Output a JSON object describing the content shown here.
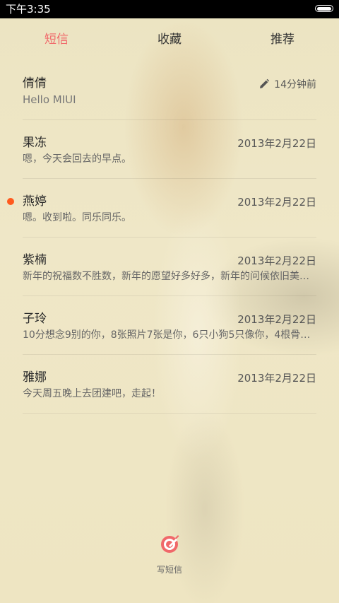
{
  "status": {
    "time": "下午3:35"
  },
  "tabs": [
    {
      "label": "短信",
      "active": true
    },
    {
      "label": "收藏",
      "active": false
    },
    {
      "label": "推荐",
      "active": false
    }
  ],
  "threads": [
    {
      "name": "倩倩",
      "preview": "Hello MIUI",
      "time": "14分钟前",
      "draft": true,
      "unread": false
    },
    {
      "name": "果冻",
      "preview": "嗯，今天会回去的早点。",
      "time": "2013年2月22日",
      "draft": false,
      "unread": false
    },
    {
      "name": "燕婷",
      "preview": "嗯。收到啦。同乐同乐。",
      "time": "2013年2月22日",
      "draft": false,
      "unread": true
    },
    {
      "name": "紫楠",
      "preview": "新年的祝福数不胜数，新年的愿望好多好多，新年的问候依旧美好…",
      "time": "2013年2月22日",
      "draft": false,
      "unread": false
    },
    {
      "name": "子玲",
      "preview": "10分想念9别的你，8张照片7张是你，6只小狗5只像你，4根骨头…",
      "time": "2013年2月22日",
      "draft": false,
      "unread": false
    },
    {
      "name": "雅娜",
      "preview": "今天周五晚上去团建吧，走起！",
      "time": "2013年2月22日",
      "draft": false,
      "unread": false
    }
  ],
  "compose": {
    "label": "写短信"
  },
  "colors": {
    "accent": "#f0686a",
    "unread": "#ff5a1e",
    "background": "#f1e8c6"
  }
}
